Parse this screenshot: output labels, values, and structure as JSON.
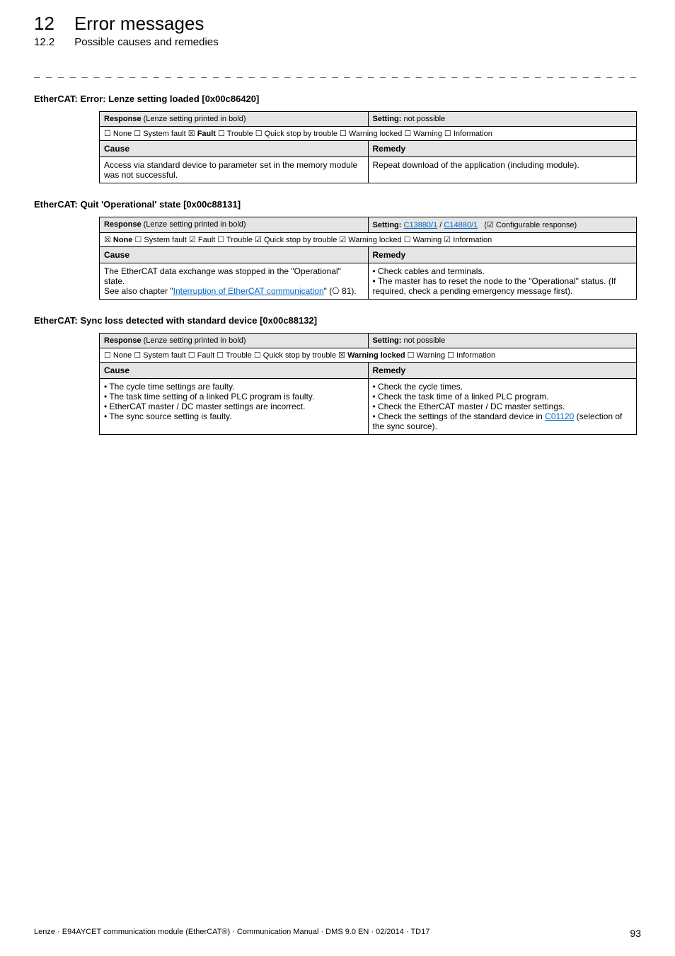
{
  "header": {
    "chapter_number": "12",
    "chapter_title": "Error messages",
    "section_number": "12.2",
    "section_title": "Possible causes and remedies",
    "dash_rule": "_ _ _ _ _ _ _ _ _ _ _ _ _ _ _ _ _ _ _ _ _ _ _ _ _ _ _ _ _ _ _ _ _ _ _ _ _ _ _ _ _ _ _ _ _ _ _ _ _ _ _ _ _ _ _ _ _ _ _ _ _ _ _ _"
  },
  "labels": {
    "response_prefix": "Response",
    "response_suffix": " (Lenze setting printed in bold)",
    "setting_prefix": "Setting:",
    "setting_not_possible": " not possible",
    "setting_configurable": "Configurable response)",
    "cause": "Cause",
    "remedy": "Remedy"
  },
  "entries": [
    {
      "title": "EtherCAT: Error: Lenze setting loaded [0x00c86420]",
      "setting_type": "not_possible",
      "flags_html": "☐ None  ☐ System fault  ☒ <b>Fault</b>  ☐ Trouble  ☐ Quick stop by trouble  ☐ Warning locked  ☐ Warning  ☐ Information",
      "cause_html": "Access via standard device to parameter set in the memory module was not successful.",
      "remedy_html": "Repeat download of the application (including module)."
    },
    {
      "title": "EtherCAT: Quit 'Operational' state [0x00c88131]",
      "setting_type": "configurable",
      "setting_links": [
        "C13880/1",
        "C14880/1"
      ],
      "flags_html": "☒ <b>None</b>  ☐ System fault  ☑ Fault  ☐ Trouble  ☑ Quick stop by trouble  ☑ Warning locked  ☐ Warning  ☑ Information",
      "cause_html": "The EtherCAT data exchange was stopped in the \"Operational\" state.<br>See also chapter \"<span class='link'>Interruption of EtherCAT communication</span>\" (⎔ 81).",
      "remedy_html": "• Check cables and terminals.<br>• The master has to reset the node to the \"Operational\" status. (If required, check a pending emergency message first)."
    },
    {
      "title": "EtherCAT: Sync loss detected with standard device [0x00c88132]",
      "setting_type": "not_possible",
      "flags_html": "☐ None  ☐ System fault  ☐ Fault  ☐ Trouble  ☐ Quick stop by trouble  ☒ <b>Warning locked</b>  ☐ Warning  ☐ Information",
      "cause_html": "• The cycle time settings are faulty.<br>• The task time setting of a linked PLC program is faulty.<br>• EtherCAT master / DC master settings are incorrect.<br>• The sync source setting is faulty.",
      "remedy_html": "• Check the cycle times.<br>• Check the task time of a linked PLC program.<br>• Check the EtherCAT master / DC master settings.<br>• Check the settings of the standard device in <span class='link'>C01120</span> (selection of the sync source)."
    }
  ],
  "footer": {
    "left": "Lenze · E94AYCET communication module (EtherCAT®) · Communication Manual · DMS 9.0 EN · 02/2014 · TD17",
    "page": "93"
  }
}
